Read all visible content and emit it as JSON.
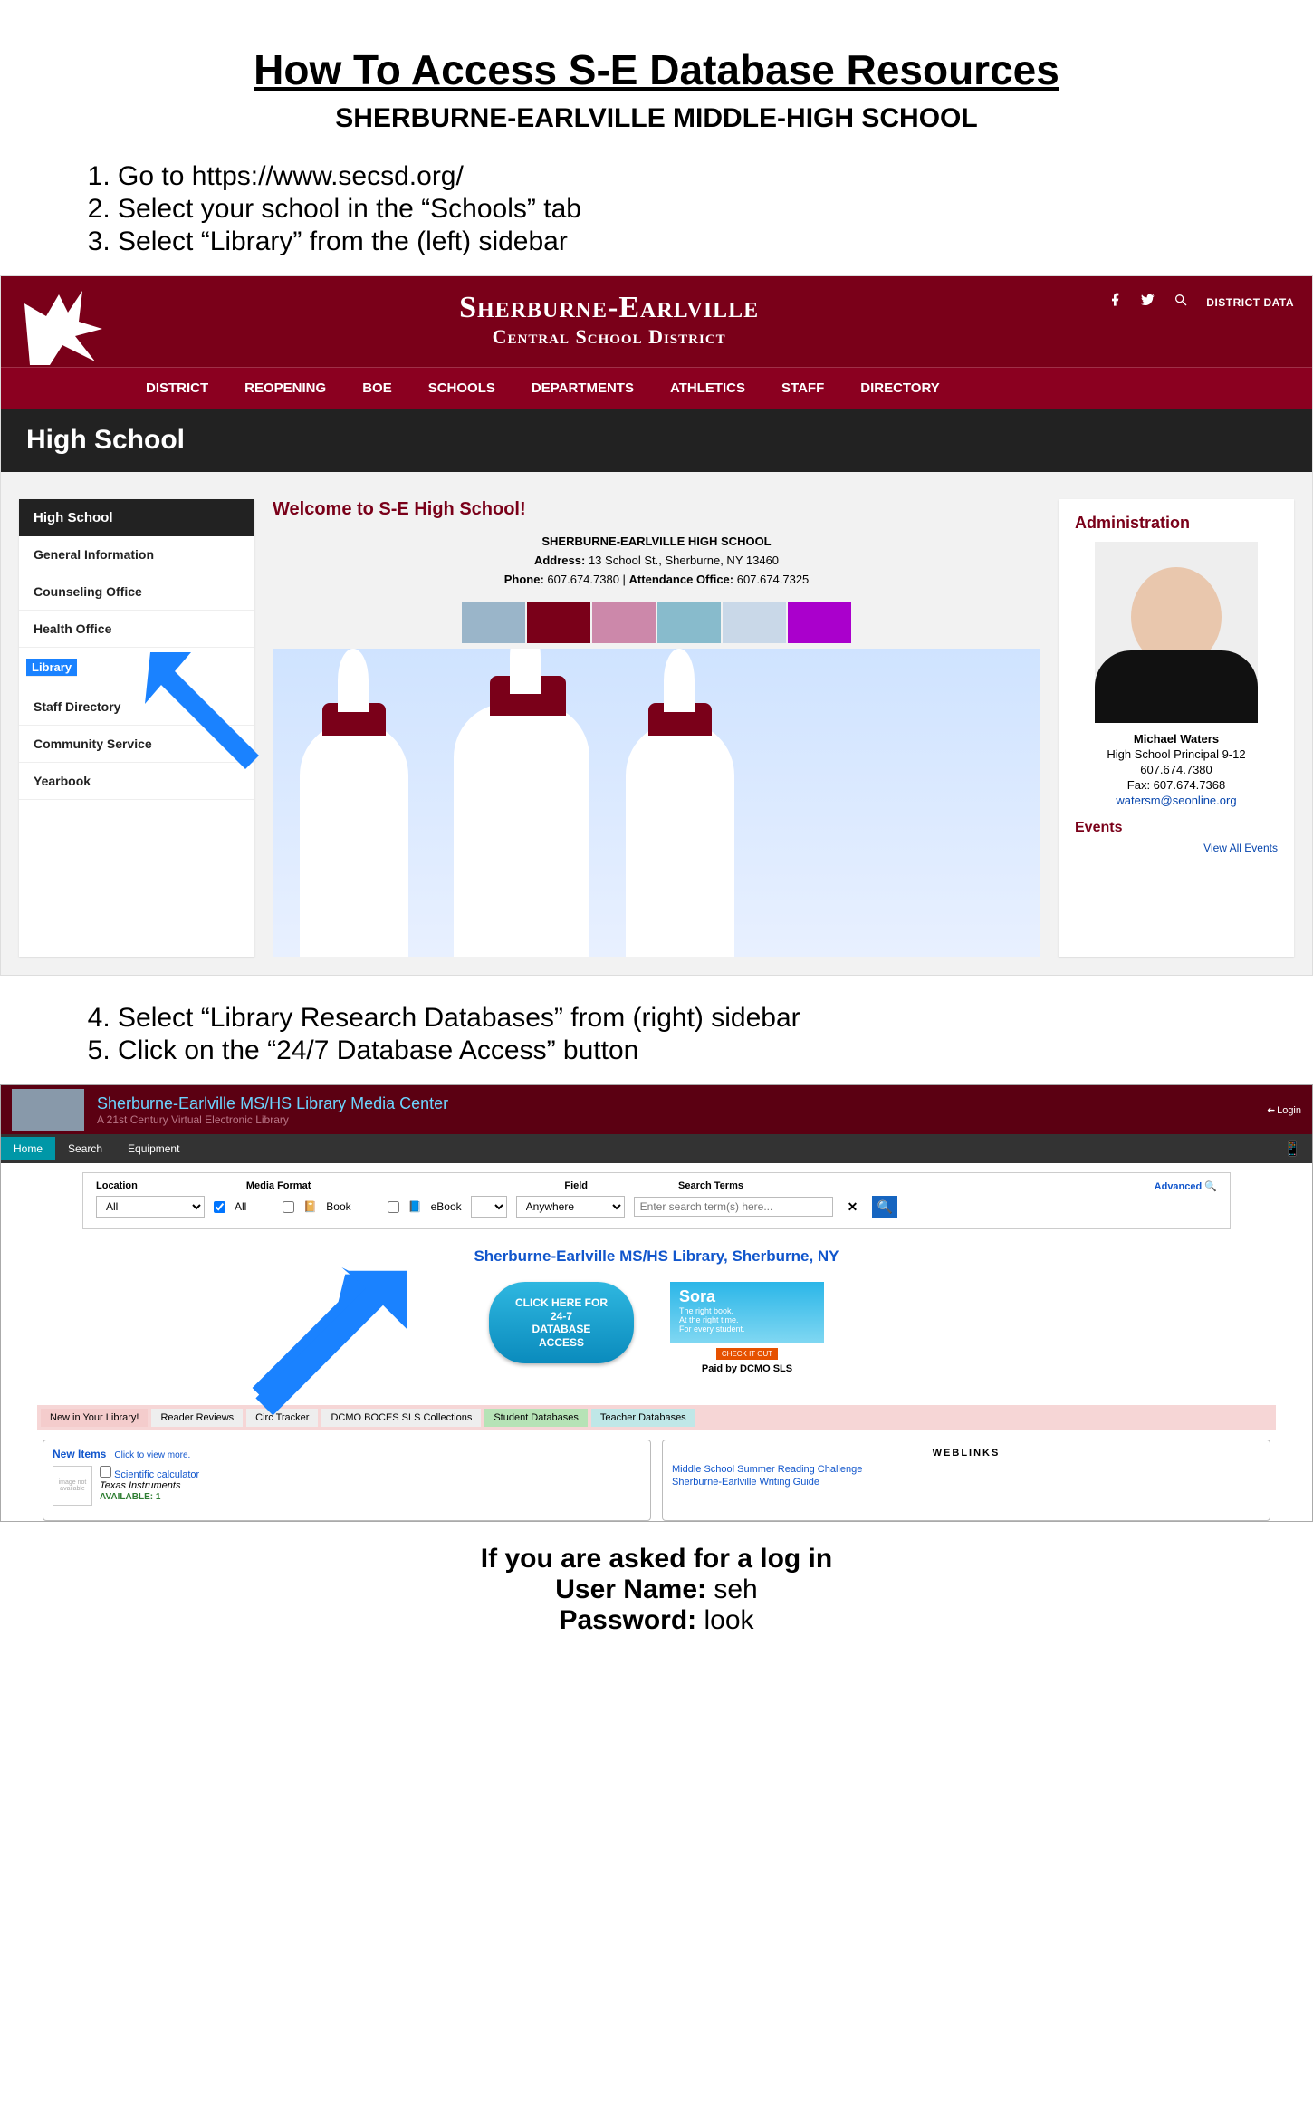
{
  "title": "How To Access S-E Database Resources",
  "subtitle": "SHERBURNE-EARLVILLE MIDDLE-HIGH SCHOOL",
  "steps_a": [
    "Go to https://www.secsd.org/",
    "Select your school in the “Schools” tab",
    "Select “Library” from the (left) sidebar"
  ],
  "steps_b": [
    "Select “Library Research Databases” from (right) sidebar",
    "Click on the “24/7 Database Access” button"
  ],
  "shot1": {
    "site_title_big": "Sherburne-Earlville",
    "site_title_small": "Central School District",
    "district_data": "DISTRICT DATA",
    "nav": [
      "DISTRICT",
      "REOPENING",
      "BOE",
      "SCHOOLS",
      "DEPARTMENTS",
      "ATHLETICS",
      "STAFF",
      "DIRECTORY"
    ],
    "page_band": "High School",
    "sidebar_header": "High School",
    "sidebar": [
      "General Information",
      "Counseling Office",
      "Health Office",
      "Library",
      "Staff Directory",
      "Community Service",
      "Yearbook"
    ],
    "welcome": "Welcome to S-E High School!",
    "school_name": "SHERBURNE-EARLVILLE HIGH SCHOOL",
    "address_label": "Address:",
    "address": "13 School St., Sherburne, NY 13460",
    "phone_label": "Phone:",
    "phone": "607.674.7380",
    "att_label": "Attendance Office:",
    "att_phone": "607.674.7325",
    "admin_heading": "Administration",
    "principal_name": "Michael Waters",
    "principal_title": "High School Principal 9-12",
    "principal_phone": "607.674.7380",
    "principal_fax": "Fax: 607.674.7368",
    "principal_email": "watersm@seonline.org",
    "events_heading": "Events",
    "view_all": "View All Events"
  },
  "shot2": {
    "head_title": "Sherburne-Earlville MS/HS Library Media Center",
    "head_sub": "A 21st Century Virtual Electronic Library",
    "login": "Login",
    "tabs": [
      "Home",
      "Search",
      "Equipment"
    ],
    "labels": {
      "location": "Location",
      "media": "Media Format",
      "field": "Field",
      "terms": "Search Terms",
      "advanced": "Advanced"
    },
    "location_value": "All",
    "media_all": "All",
    "media_book": "Book",
    "media_ebook": "eBook",
    "field_value": "Anywhere",
    "terms_placeholder": "Enter search term(s) here...",
    "lib_name": "Sherburne-Earlville MS/HS Library, Sherburne, NY",
    "pill_line1": "CLICK HERE FOR 24-7",
    "pill_line2": "DATABASE ACCESS",
    "sora_brand": "Sora",
    "sora_tag1": "The right book.",
    "sora_tag2": "At the right time.",
    "sora_tag3": "For every student.",
    "sora_check": "CHECK IT OUT",
    "sora_paid": "Paid by DCMO SLS",
    "bottom_tabs": [
      "New in Your Library!",
      "Reader Reviews",
      "Circ Tracker",
      "DCMO BOCES SLS Collections",
      "Student Databases",
      "Teacher Databases"
    ],
    "new_items": "New Items",
    "click_more": "Click to view more.",
    "item_title": "Scientific calculator",
    "item_maker": "Texas Instruments",
    "item_avail": "AVAILABLE: 1",
    "weblinks": "WEBLINKS",
    "link1": "Middle School Summer Reading Challenge",
    "link2": "Sherburne-Earlville Writing Guide",
    "img_placeholder": "image not available"
  },
  "creds": {
    "ask": "If you are asked for a log in",
    "user_label": "User Name:",
    "user": "seh",
    "pass_label": "Password:",
    "pass": "look"
  }
}
